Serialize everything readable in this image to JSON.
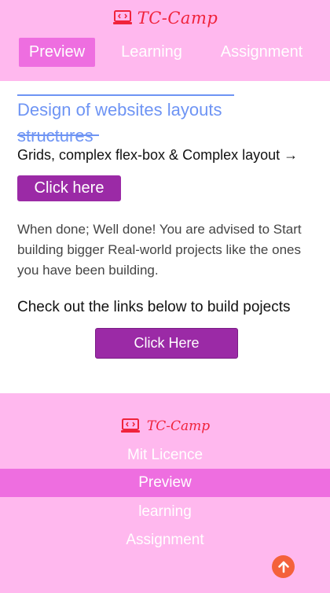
{
  "header": {
    "brand": "TC-Camp",
    "logo_icon": "laptop-code-icon",
    "tabs": [
      {
        "label": "Preview",
        "active": true
      },
      {
        "label": "Learning",
        "active": false
      },
      {
        "label": "Assignment",
        "active": false
      }
    ]
  },
  "main": {
    "title": "Design of websites layouts structures",
    "subtitle": "Grids, complex flex-box & Complex layout →",
    "button1_label": "Click here",
    "paragraph": "When done; Well done! You are advised to Start building bigger Real-world projects like the ones you have been building.",
    "checkout_text": "Check out the links below to build pojects",
    "button2_label": "Click Here"
  },
  "footer": {
    "brand": "TC-Camp",
    "license": "Mit Licence",
    "links": [
      {
        "label": "Preview",
        "active": true
      },
      {
        "label": "learning",
        "active": false
      },
      {
        "label": "Assignment",
        "active": false
      }
    ],
    "scroll_top_icon": "arrow-up-circle-icon"
  },
  "colors": {
    "header_bg": "#ffb8ee",
    "active_tab": "#ee6ee0",
    "brand_red": "#f0233c",
    "title_blue": "#6e94f4",
    "button_purple": "#9b2aa6",
    "scroll_orange": "#f4613b"
  }
}
